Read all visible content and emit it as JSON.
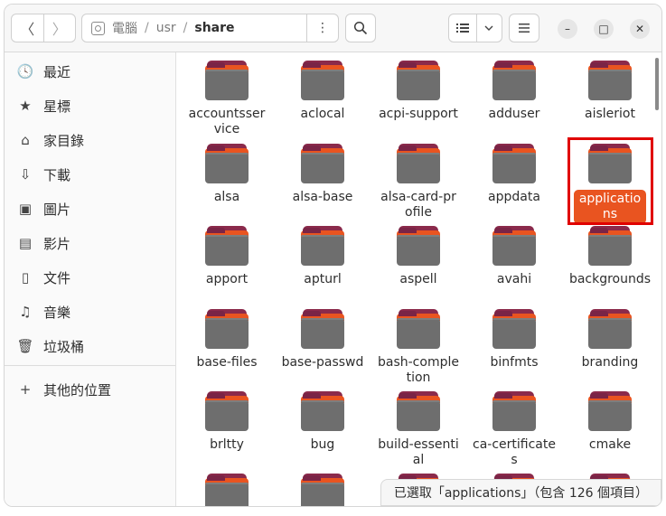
{
  "header": {
    "back_icon": "chevron-left-icon",
    "forward_icon": "chevron-right-icon",
    "path": {
      "drive_icon": "drive-icon",
      "segments": [
        "電腦",
        "usr",
        "share"
      ],
      "menu_icon": "vertical-dots-icon"
    },
    "search_icon": "search-icon",
    "view_icon": "list-view-icon",
    "view_dropdown_icon": "chevron-down-icon",
    "menu_icon": "hamburger-icon",
    "window": {
      "minimize": "–",
      "maximize": "□",
      "close": "✕"
    }
  },
  "sidebar": {
    "items": [
      {
        "icon": "clock-icon",
        "glyph": "🕓",
        "label": "最近"
      },
      {
        "icon": "star-icon",
        "glyph": "★",
        "label": "星標"
      },
      {
        "icon": "home-icon",
        "glyph": "⌂",
        "label": "家目錄"
      },
      {
        "icon": "download-icon",
        "glyph": "⇩",
        "label": "下載"
      },
      {
        "icon": "picture-icon",
        "glyph": "▣",
        "label": "圖片"
      },
      {
        "icon": "film-icon",
        "glyph": "▤",
        "label": "影片"
      },
      {
        "icon": "document-icon",
        "glyph": "▯",
        "label": "文件"
      },
      {
        "icon": "music-icon",
        "glyph": "♫",
        "label": "音樂"
      },
      {
        "icon": "trash-icon",
        "glyph": "🗑",
        "label": "垃圾桶"
      },
      {
        "icon": "plus-icon",
        "glyph": "+",
        "label": "其他的位置"
      }
    ]
  },
  "files": [
    "accountsservice",
    "aclocal",
    "acpi-support",
    "adduser",
    "aisleriot",
    "alsa",
    "alsa-base",
    "alsa-card-profile",
    "appdata",
    "applications",
    "apport",
    "apturl",
    "aspell",
    "avahi",
    "backgrounds",
    "base-files",
    "base-passwd",
    "bash-completion",
    "binfmts",
    "branding",
    "brltty",
    "bug",
    "build-essential",
    "ca-certificates",
    "cmake",
    "",
    "",
    "",
    "",
    ""
  ],
  "selected_file": "applications",
  "status": "已選取「applications」（包含 126 個項目）",
  "colors": {
    "accent": "#e95420",
    "folder_tab": "#8b2a4b",
    "folder_body": "#6e6e6e",
    "highlight_box": "#e00000"
  }
}
